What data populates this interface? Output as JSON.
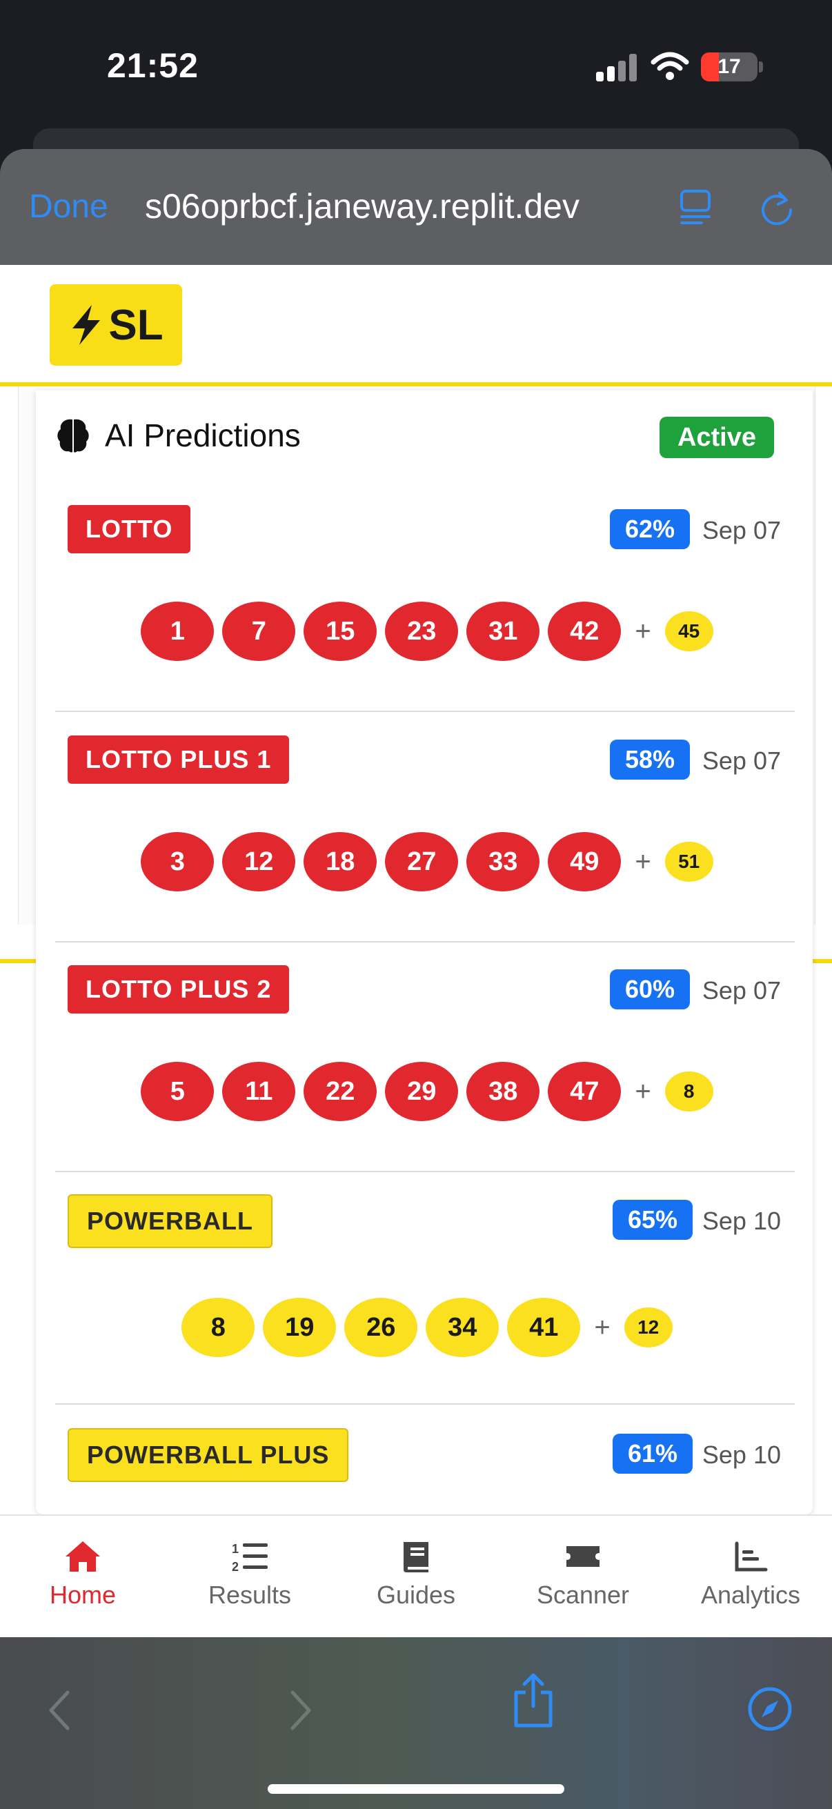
{
  "status_bar": {
    "time": "21:52",
    "battery": "17"
  },
  "browser": {
    "done_label": "Done",
    "url": "s06oprbcf.janeway.replit.dev"
  },
  "app": {
    "logo_text": "SL"
  },
  "predictions": {
    "title": "AI Predictions",
    "status": "Active",
    "items": [
      {
        "game": "LOTTO",
        "confidence": "62%",
        "date": "Sep 07",
        "numbers": [
          "1",
          "7",
          "15",
          "23",
          "31",
          "42"
        ],
        "bonus": "45"
      },
      {
        "game": "LOTTO PLUS 1",
        "confidence": "58%",
        "date": "Sep 07",
        "numbers": [
          "3",
          "12",
          "18",
          "27",
          "33",
          "49"
        ],
        "bonus": "51"
      },
      {
        "game": "LOTTO PLUS 2",
        "confidence": "60%",
        "date": "Sep 07",
        "numbers": [
          "5",
          "11",
          "22",
          "29",
          "38",
          "47"
        ],
        "bonus": "8"
      },
      {
        "game": "POWERBALL",
        "confidence": "65%",
        "date": "Sep 10",
        "numbers": [
          "8",
          "19",
          "26",
          "34",
          "41"
        ],
        "bonus": "12"
      },
      {
        "game": "POWERBALL PLUS",
        "confidence": "61%",
        "date": "Sep 10"
      }
    ]
  },
  "tabs": [
    {
      "label": "Home",
      "icon": "home-icon"
    },
    {
      "label": "Results",
      "icon": "numbered-list-icon"
    },
    {
      "label": "Guides",
      "icon": "book-icon"
    },
    {
      "label": "Scanner",
      "icon": "ticket-icon"
    },
    {
      "label": "Analytics",
      "icon": "bar-chart-icon"
    }
  ],
  "colors": {
    "brand_yellow": "#f9dd17",
    "lotto_red": "#e0282e",
    "confidence_blue": "#1672f3",
    "active_green": "#1fa23c",
    "safari_blue": "#2f8cf5"
  }
}
